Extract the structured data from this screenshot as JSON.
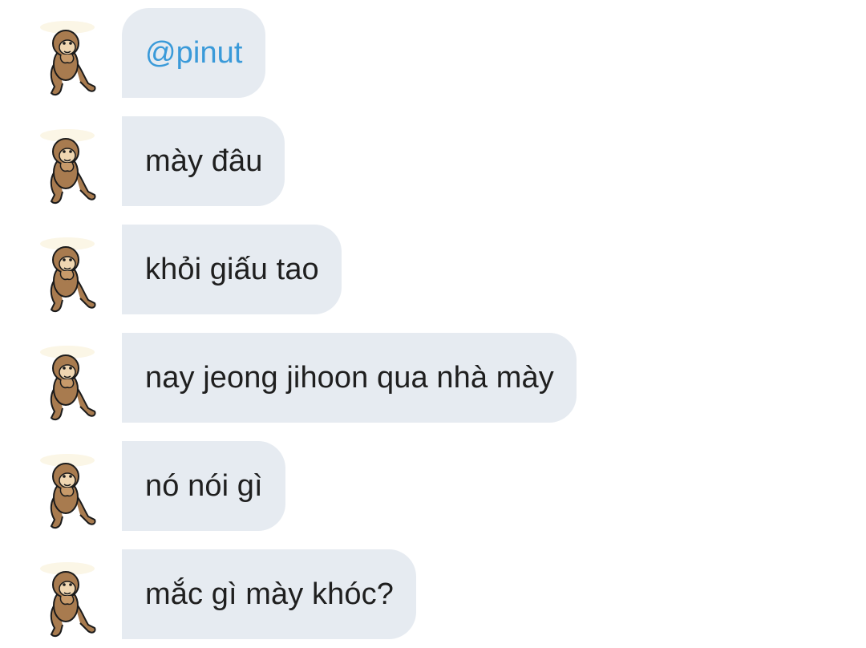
{
  "conversation": {
    "messages": [
      {
        "text": "@pinut",
        "type": "mention",
        "avatar": "monkey-sticker-icon"
      },
      {
        "text": "mày đâu",
        "type": "text",
        "avatar": "monkey-sticker-icon"
      },
      {
        "text": "khỏi giấu tao",
        "type": "text",
        "avatar": "monkey-sticker-icon"
      },
      {
        "text": "nay jeong jihoon qua nhà mày",
        "type": "text",
        "avatar": "monkey-sticker-icon"
      },
      {
        "text": "nó nói gì",
        "type": "text",
        "avatar": "monkey-sticker-icon"
      },
      {
        "text": "mắc gì mày khóc?",
        "type": "text",
        "avatar": "monkey-sticker-icon"
      }
    ]
  },
  "colors": {
    "bubble_background": "#e6ebf1",
    "text": "#1f1f1f",
    "mention": "#3a9ad9",
    "avatar_fur": "#a87b4f"
  }
}
